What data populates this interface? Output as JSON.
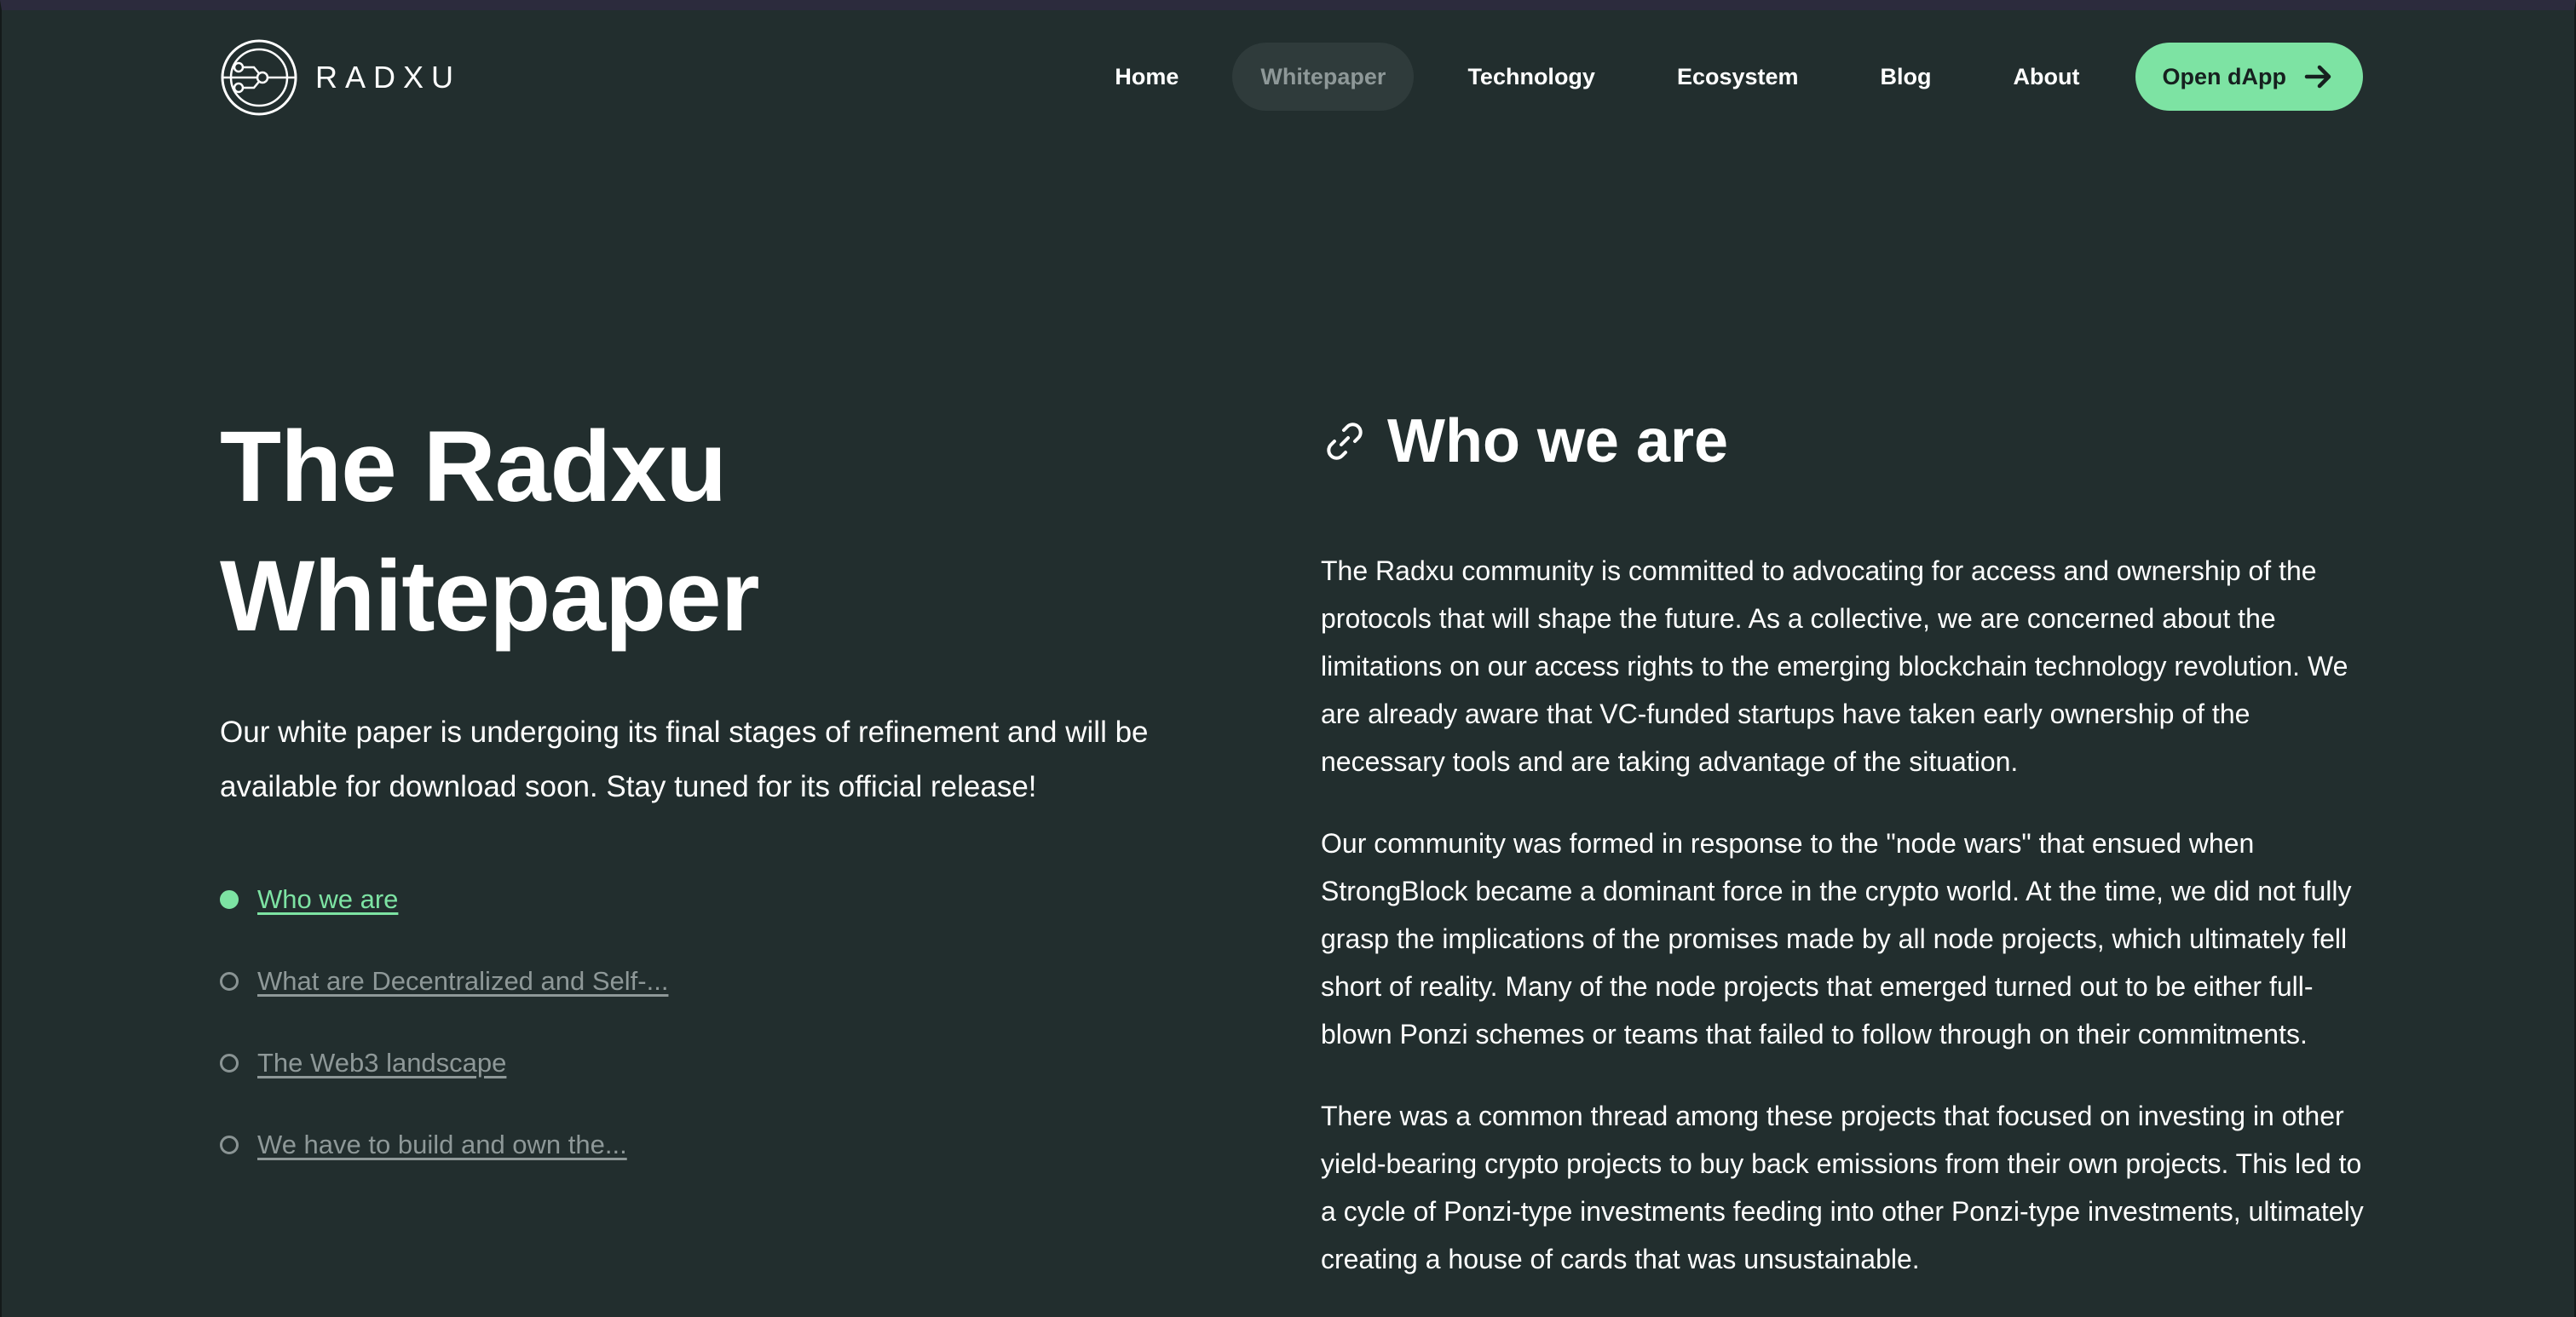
{
  "header": {
    "brand": "RADXU",
    "nav": [
      {
        "label": "Home",
        "active": false
      },
      {
        "label": "Whitepaper",
        "active": true
      },
      {
        "label": "Technology",
        "active": false
      },
      {
        "label": "Ecosystem",
        "active": false
      },
      {
        "label": "Blog",
        "active": false
      },
      {
        "label": "About",
        "active": false
      }
    ],
    "cta_label": "Open dApp",
    "cta_icon": "arrow-right-icon"
  },
  "hero": {
    "title_line1": "The Radxu",
    "title_line2": "Whitepaper",
    "intro": "Our white paper is undergoing its final stages of refinement and will be available for download soon. Stay tuned for its official release!"
  },
  "toc": [
    {
      "label": "Who we are",
      "current": true
    },
    {
      "label": "What are Decentralized and Self-...",
      "current": false
    },
    {
      "label": "The Web3 landscape",
      "current": false
    },
    {
      "label": "We have to build and own the...",
      "current": false
    }
  ],
  "section": {
    "icon": "link-icon",
    "title": "Who we are",
    "paragraphs": [
      "The Radxu community is committed to advocating for access and ownership of the protocols that will shape the future. As a collective, we are concerned about the limitations on our access rights to the emerging blockchain technology revolution. We are already aware that VC-funded startups have taken early ownership of the necessary tools and are taking advantage of the situation.",
      "Our community was formed in response to the \"node wars\" that ensued when StrongBlock became a dominant force in the crypto world. At the time, we did not fully grasp the implications of the promises made by all node projects, which ultimately fell short of reality. Many of the node projects that emerged turned out to be either full-blown Ponzi schemes or teams that failed to follow through on their commitments.",
      "There was a common thread among these projects that focused on investing in other yield-bearing crypto projects to buy back emissions from their own projects. This led to a cycle of Ponzi-type investments feeding into other Ponzi-type investments, ultimately creating a house of cards that was unsustainable."
    ]
  },
  "colors": {
    "background": "#222e2e",
    "accent": "#7de3a3",
    "muted": "#8e9898",
    "nav_active_bg": "#2f3b3b"
  }
}
